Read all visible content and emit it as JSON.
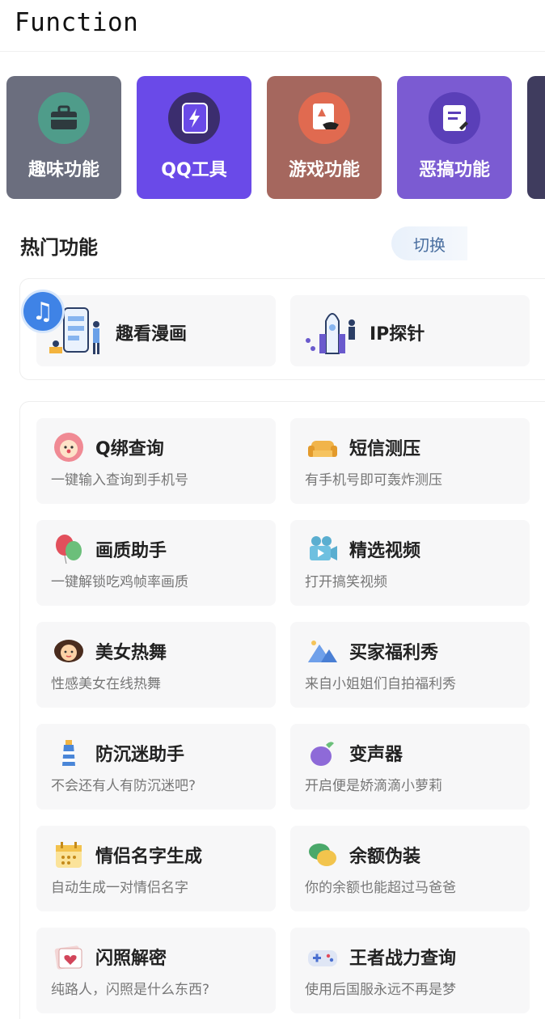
{
  "header": {
    "title": "Function"
  },
  "categories": [
    {
      "label": "趣味功能",
      "color": "#6b6e7e",
      "icon": "briefcase-icon"
    },
    {
      "label": "QQ工具",
      "color": "#6a4ae8",
      "icon": "lightning-card-icon"
    },
    {
      "label": "游戏功能",
      "color": "#a5675e",
      "icon": "game-scroll-icon"
    },
    {
      "label": "恶搞功能",
      "color": "#7b5bd2",
      "icon": "document-edit-icon"
    },
    {
      "label": "",
      "color": "#3f3c5e",
      "icon": ""
    }
  ],
  "hot": {
    "title": "热门功能",
    "switch_label": "切换",
    "items": [
      {
        "label": "趣看漫画",
        "icon": "phone-reader-illustration"
      },
      {
        "label": "IP探针",
        "icon": "rocket-launch-illustration"
      }
    ],
    "music_icon": "music-note-icon"
  },
  "functions": [
    {
      "name": "Q绑查询",
      "desc": "一键输入查询到手机号",
      "icon": "clown-face-icon"
    },
    {
      "name": "短信测压",
      "desc": "有手机号即可轰炸测压",
      "icon": "sofa-icon"
    },
    {
      "name": "画质助手",
      "desc": "一键解锁吃鸡帧率画质",
      "icon": "balloons-icon"
    },
    {
      "name": "精选视频",
      "desc": "打开搞笑视频",
      "icon": "video-camera-icon"
    },
    {
      "name": "美女热舞",
      "desc": "性感美女在线热舞",
      "icon": "girl-face-icon"
    },
    {
      "name": "买家福利秀",
      "desc": "来自小姐姐们自拍福利秀",
      "icon": "mountain-photo-icon"
    },
    {
      "name": "防沉迷助手",
      "desc": "不会还有人有防沉迷吧?",
      "icon": "lighthouse-icon"
    },
    {
      "name": "变声器",
      "desc": "开启便是娇滴滴小萝莉",
      "icon": "eggplant-icon"
    },
    {
      "name": "情侣名字生成",
      "desc": "自动生成一对情侣名字",
      "icon": "calendar-icon"
    },
    {
      "name": "余额伪装",
      "desc": "你的余额也能超过马爸爸",
      "icon": "chat-bubbles-icon"
    },
    {
      "name": "闪照解密",
      "desc": "纯路人，闪照是什么东西?",
      "icon": "heart-photo-icon"
    },
    {
      "name": "王者战力查询",
      "desc": "使用后国服永远不再是梦",
      "icon": "gamepad-icon"
    }
  ]
}
